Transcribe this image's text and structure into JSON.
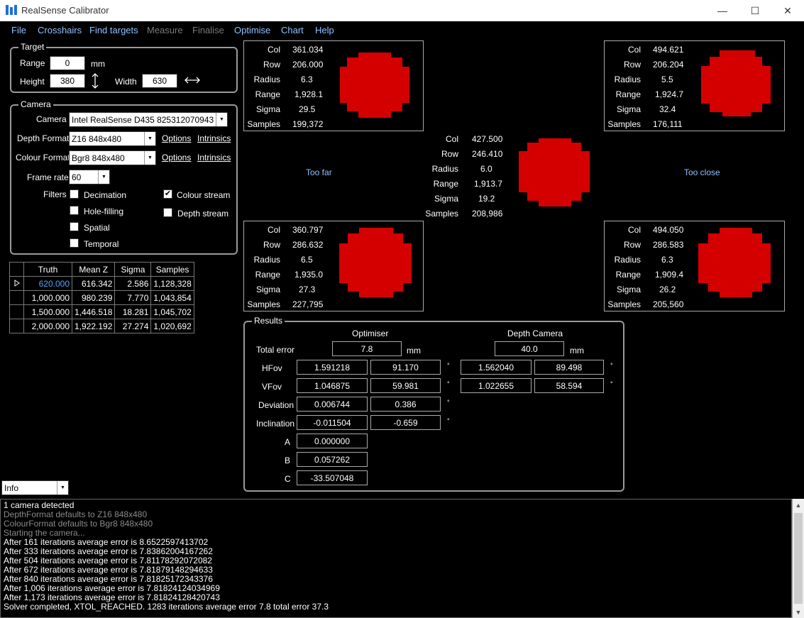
{
  "window": {
    "title": "RealSense Calibrator",
    "minimize": "—",
    "maximize": "☐",
    "close": "✕"
  },
  "menu": [
    {
      "label": "File",
      "enabled": true
    },
    {
      "label": "Crosshairs",
      "enabled": true
    },
    {
      "label": "Find targets",
      "enabled": true
    },
    {
      "label": "Measure",
      "enabled": false
    },
    {
      "label": "Finalise",
      "enabled": false
    },
    {
      "label": "Optimise",
      "enabled": true
    },
    {
      "label": "Chart",
      "enabled": true
    },
    {
      "label": "Help",
      "enabled": true
    }
  ],
  "target": {
    "group_title": "Target",
    "range_label": "Range",
    "range_value": "0",
    "range_unit": "mm",
    "height_label": "Height",
    "height_value": "380",
    "width_label": "Width",
    "width_value": "630"
  },
  "camera": {
    "group_title": "Camera",
    "camera_label": "Camera",
    "camera_value": "Intel RealSense D435 825312070943",
    "depth_format_label": "Depth Format",
    "depth_format_value": "Z16 848x480",
    "colour_format_label": "Colour Format",
    "colour_format_value": "Bgr8 848x480",
    "options_label": "Options",
    "intrinsics_label": "Intrinsics",
    "frame_rate_label": "Frame rate",
    "frame_rate_value": "60",
    "filters_label": "Filters",
    "filters": [
      {
        "label": "Decimation",
        "checked": false
      },
      {
        "label": "Hole-filling",
        "checked": false
      },
      {
        "label": "Spatial",
        "checked": false
      },
      {
        "label": "Temporal",
        "checked": false
      }
    ],
    "streams": [
      {
        "label": "Colour stream",
        "checked": true
      },
      {
        "label": "Depth stream",
        "checked": false
      }
    ]
  },
  "truth_table": {
    "headers": [
      "Truth",
      "Mean Z",
      "Sigma",
      "Samples"
    ],
    "rows": [
      [
        "620.000",
        "616.342",
        "2.586",
        "1,128,328"
      ],
      [
        "1,000.000",
        "980.239",
        "7.770",
        "1,043,854"
      ],
      [
        "1,500.000",
        "1,446.518",
        "18.281",
        "1,045,702"
      ],
      [
        "2,000.000",
        "1,922.192",
        "27.274",
        "1,020,692"
      ]
    ]
  },
  "stat_labels": [
    "Col",
    "Row",
    "Radius",
    "Range",
    "Sigma",
    "Samples"
  ],
  "panels": {
    "top_left": [
      "361.034",
      "206.000",
      "6.3",
      "1,928.1",
      "29.5",
      "199,372"
    ],
    "top_right": [
      "494.621",
      "206.204",
      "5.5",
      "1,924.7",
      "32.4",
      "176,111"
    ],
    "center": [
      "427.500",
      "246.410",
      "6.0",
      "1,913.7",
      "19.2",
      "208,986"
    ],
    "bottom_left": [
      "360.797",
      "286.632",
      "6.5",
      "1,935.0",
      "27.3",
      "227,795"
    ],
    "bottom_right": [
      "494.050",
      "286.583",
      "6.3",
      "1,909.4",
      "26.2",
      "205,560"
    ],
    "too_far": "Too far",
    "too_close": "Too close"
  },
  "results": {
    "group_title": "Results",
    "optimiser_header": "Optimiser",
    "depth_camera_header": "Depth Camera",
    "total_error_label": "Total error",
    "total_error_opt": "7.8",
    "total_error_cam": "40.0",
    "unit_mm": "mm",
    "degree": "°",
    "hfov_label": "HFov",
    "hfov": [
      "1.591218",
      "91.170",
      "1.562040",
      "89.498"
    ],
    "vfov_label": "VFov",
    "vfov": [
      "1.046875",
      "59.981",
      "1.022655",
      "58.594"
    ],
    "deviation_label": "Deviation",
    "deviation": [
      "0.006744",
      "0.386"
    ],
    "inclination_label": "Inclination",
    "inclination": [
      "-0.011504",
      "-0.659"
    ],
    "a_label": "A",
    "a_value": "0.000000",
    "b_label": "B",
    "b_value": "0.057262",
    "c_label": "C",
    "c_value": "-33.507048"
  },
  "log_level": "Info",
  "log": [
    {
      "text": "1 camera detected",
      "dim": false
    },
    {
      "text": "DepthFormat defaults to Z16 848x480",
      "dim": true
    },
    {
      "text": "ColourFormat defaults to Bgr8 848x480",
      "dim": true
    },
    {
      "text": "Starting the camera...",
      "dim": true
    },
    {
      "text": "After 161 iterations average error is 8.6522597413702",
      "dim": false
    },
    {
      "text": "After 333 iterations average error is 7.83862004167262",
      "dim": false
    },
    {
      "text": "After 504 iterations average error is 7.81178292072082",
      "dim": false
    },
    {
      "text": "After 672 iterations average error is 7.81879148294633",
      "dim": false
    },
    {
      "text": "After 840 iterations average error is 7.81825172343376",
      "dim": false
    },
    {
      "text": "After 1,006 iterations average error is 7.81824124034969",
      "dim": false
    },
    {
      "text": "After 1,173 iterations average error is 7.81824128420743",
      "dim": false
    },
    {
      "text": "Solver completed, XTOL_REACHED. 1283 iterations average error 7.8 total error 37.3",
      "dim": false
    }
  ]
}
